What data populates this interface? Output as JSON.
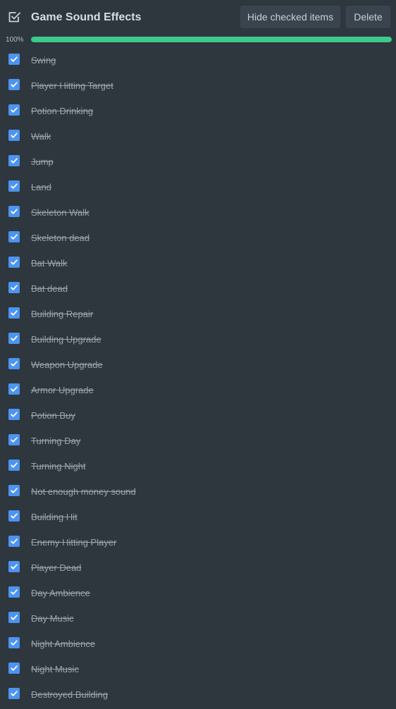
{
  "header": {
    "icon": "checklist-icon",
    "title": "Game Sound Effects",
    "hide_checked_label": "Hide checked items",
    "delete_label": "Delete"
  },
  "progress": {
    "label": "100%",
    "fraction": 1.0,
    "color": "#3dc98a"
  },
  "colors": {
    "background": "#2e363e",
    "checkbox": "#4c94f0",
    "button_bg": "#3a444e"
  },
  "items": [
    {
      "label": "Swing",
      "checked": true
    },
    {
      "label": "Player Hitting Target",
      "checked": true
    },
    {
      "label": "Potion Drinking",
      "checked": true
    },
    {
      "label": "Walk",
      "checked": true
    },
    {
      "label": "Jump",
      "checked": true
    },
    {
      "label": "Land",
      "checked": true
    },
    {
      "label": "Skeleton Walk",
      "checked": true
    },
    {
      "label": "Skeleton dead",
      "checked": true
    },
    {
      "label": "Bat Walk",
      "checked": true
    },
    {
      "label": "Bat dead",
      "checked": true
    },
    {
      "label": "Building Repair",
      "checked": true
    },
    {
      "label": "Building Upgrade",
      "checked": true
    },
    {
      "label": "Weapon Upgrade",
      "checked": true
    },
    {
      "label": "Armor Upgrade",
      "checked": true
    },
    {
      "label": "Potion Buy",
      "checked": true
    },
    {
      "label": "Turning Day",
      "checked": true
    },
    {
      "label": "Turning Night",
      "checked": true
    },
    {
      "label": "Not enough money sound",
      "checked": true
    },
    {
      "label": "Building Hit",
      "checked": true
    },
    {
      "label": "Enemy Hitting Player",
      "checked": true
    },
    {
      "label": "Player Dead",
      "checked": true
    },
    {
      "label": "Day Ambience",
      "checked": true
    },
    {
      "label": "Day Music",
      "checked": true
    },
    {
      "label": "Night Ambience",
      "checked": true
    },
    {
      "label": "Night Music",
      "checked": true
    },
    {
      "label": "Destroyed Building",
      "checked": true
    }
  ]
}
